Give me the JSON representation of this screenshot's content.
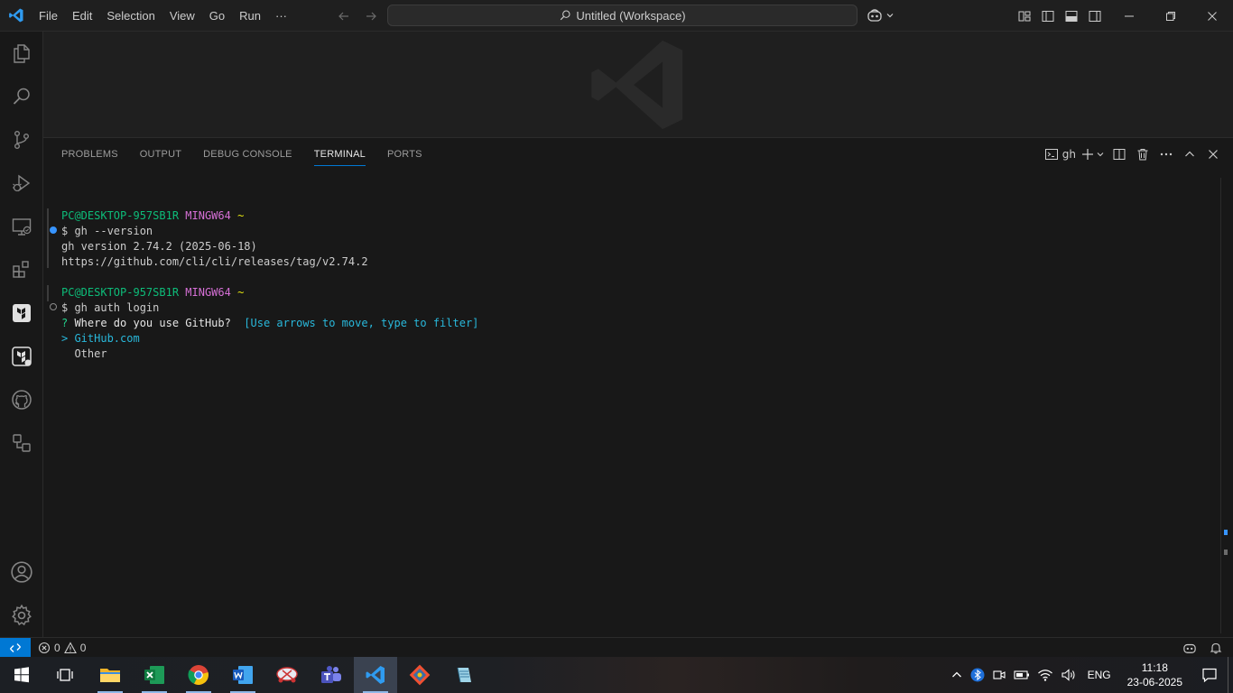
{
  "titlebar": {
    "menu": [
      "File",
      "Edit",
      "Selection",
      "View",
      "Go",
      "Run",
      "···"
    ],
    "search_text": "Untitled (Workspace)"
  },
  "panel": {
    "tabs": [
      {
        "label": "PROBLEMS",
        "active": false
      },
      {
        "label": "OUTPUT",
        "active": false
      },
      {
        "label": "DEBUG CONSOLE",
        "active": false
      },
      {
        "label": "TERMINAL",
        "active": true
      },
      {
        "label": "PORTS",
        "active": false
      }
    ],
    "terminal_name": "gh"
  },
  "terminal": {
    "prompt1_user": "PC@DESKTOP-957SB1R",
    "prompt1_env": "MINGW64",
    "prompt1_dir": "~",
    "cmd1": "$ gh --version",
    "out1": "gh version 2.74.2 (2025-06-18)",
    "out2": "https://github.com/cli/cli/releases/tag/v2.74.2",
    "prompt2_user": "PC@DESKTOP-957SB1R",
    "prompt2_env": "MINGW64",
    "prompt2_dir": "~",
    "cmd2": "$ gh auth login",
    "question_mark": "?",
    "question": " Where do you use GitHub?",
    "hint": "  [Use arrows to move, type to filter]",
    "option1_marker": ">",
    "option1": " GitHub.com",
    "option2": "  Other"
  },
  "statusbar": {
    "errors": "0",
    "warnings": "0"
  },
  "taskbar": {
    "lang": "ENG",
    "time": "11:18",
    "date": "23-06-2025"
  },
  "colors": {
    "accent": "#0078d4",
    "prompt_green": "#23d18b",
    "prompt_magenta": "#d670d6",
    "prompt_yellow": "#e5e510",
    "hint_cyan": "#29b8db"
  }
}
